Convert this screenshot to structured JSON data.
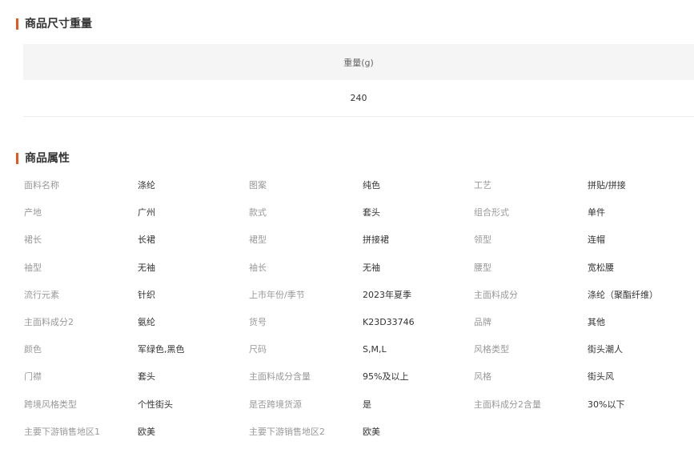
{
  "size_section": {
    "title": "商品尺寸重量",
    "header": "重量(g)",
    "value": "240"
  },
  "attr_section": {
    "title": "商品属性",
    "rows": [
      [
        {
          "label": "面料名称",
          "value": "涤纶"
        },
        {
          "label": "图案",
          "value": "纯色"
        },
        {
          "label": "工艺",
          "value": "拼贴/拼接"
        }
      ],
      [
        {
          "label": "产地",
          "value": "广州"
        },
        {
          "label": "款式",
          "value": "套头"
        },
        {
          "label": "组合形式",
          "value": "单件"
        }
      ],
      [
        {
          "label": "裙长",
          "value": "长裙"
        },
        {
          "label": "裙型",
          "value": "拼接裙"
        },
        {
          "label": "领型",
          "value": "连帽"
        }
      ],
      [
        {
          "label": "袖型",
          "value": "无袖"
        },
        {
          "label": "袖长",
          "value": "无袖"
        },
        {
          "label": "腰型",
          "value": "宽松腰"
        }
      ],
      [
        {
          "label": "流行元素",
          "value": "针织"
        },
        {
          "label": "上市年份/季节",
          "value": "2023年夏季"
        },
        {
          "label": "主面料成分",
          "value": "涤纶（聚酯纤维）"
        }
      ],
      [
        {
          "label": "主面料成分2",
          "value": "氨纶"
        },
        {
          "label": "货号",
          "value": "K23D33746"
        },
        {
          "label": "品牌",
          "value": "其他"
        }
      ],
      [
        {
          "label": "颜色",
          "value": "军绿色,黑色"
        },
        {
          "label": "尺码",
          "value": "S,M,L"
        },
        {
          "label": "风格类型",
          "value": "街头潮人"
        }
      ],
      [
        {
          "label": "门襟",
          "value": "套头"
        },
        {
          "label": "主面料成分含量",
          "value": "95%及以上"
        },
        {
          "label": "风格",
          "value": "街头风"
        }
      ],
      [
        {
          "label": "跨境风格类型",
          "value": "个性街头"
        },
        {
          "label": "是否跨境货源",
          "value": "是"
        },
        {
          "label": "主面料成分2含量",
          "value": "30%以下"
        }
      ],
      [
        {
          "label": "主要下游销售地区1",
          "value": "欧美"
        },
        {
          "label": "主要下游销售地区2",
          "value": "欧美"
        }
      ]
    ]
  }
}
